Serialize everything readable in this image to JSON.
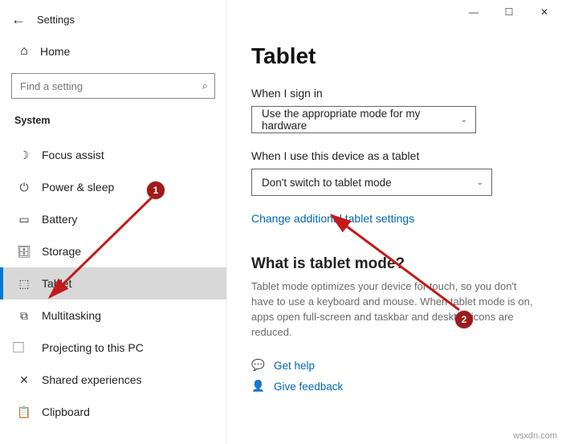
{
  "window": {
    "title": "Settings",
    "controls": {
      "min": "—",
      "max": "☐",
      "close": "✕"
    }
  },
  "sidebar": {
    "home_label": "Home",
    "search_placeholder": "Find a setting",
    "section_label": "System",
    "items": [
      {
        "icon": "focus-assist-icon",
        "label": "Focus assist",
        "glyph": "☽"
      },
      {
        "icon": "power-sleep-icon",
        "label": "Power & sleep",
        "glyph": "⏻"
      },
      {
        "icon": "battery-icon",
        "label": "Battery",
        "glyph": "▭"
      },
      {
        "icon": "storage-icon",
        "label": "Storage",
        "glyph": "🗄"
      },
      {
        "icon": "tablet-icon",
        "label": "Tablet",
        "glyph": "⬚"
      },
      {
        "icon": "multitasking-icon",
        "label": "Multitasking",
        "glyph": "⧉"
      },
      {
        "icon": "projecting-icon",
        "label": "Projecting to this PC",
        "glyph": "⃞"
      },
      {
        "icon": "shared-experiences-icon",
        "label": "Shared experiences",
        "glyph": "✕"
      },
      {
        "icon": "clipboard-icon",
        "label": "Clipboard",
        "glyph": "📋"
      }
    ],
    "selected_index": 4
  },
  "content": {
    "page_title": "Tablet",
    "sign_in_label": "When I sign in",
    "sign_in_value": "Use the appropriate mode for my hardware",
    "tablet_use_label": "When I use this device as a tablet",
    "tablet_use_value": "Don't switch to tablet mode",
    "additional_link": "Change additional tablet settings",
    "what_is_heading": "What is tablet mode?",
    "what_is_desc": "Tablet mode optimizes your device for touch, so you don't have to use a keyboard and mouse. When tablet mode is on, apps open full-screen and taskbar and desktop icons are reduced.",
    "get_help": "Get help",
    "give_feedback": "Give feedback"
  },
  "annotations": {
    "badge1": "1",
    "badge2": "2",
    "color": "#9e1b1b"
  },
  "watermark": "wsxdn.com"
}
